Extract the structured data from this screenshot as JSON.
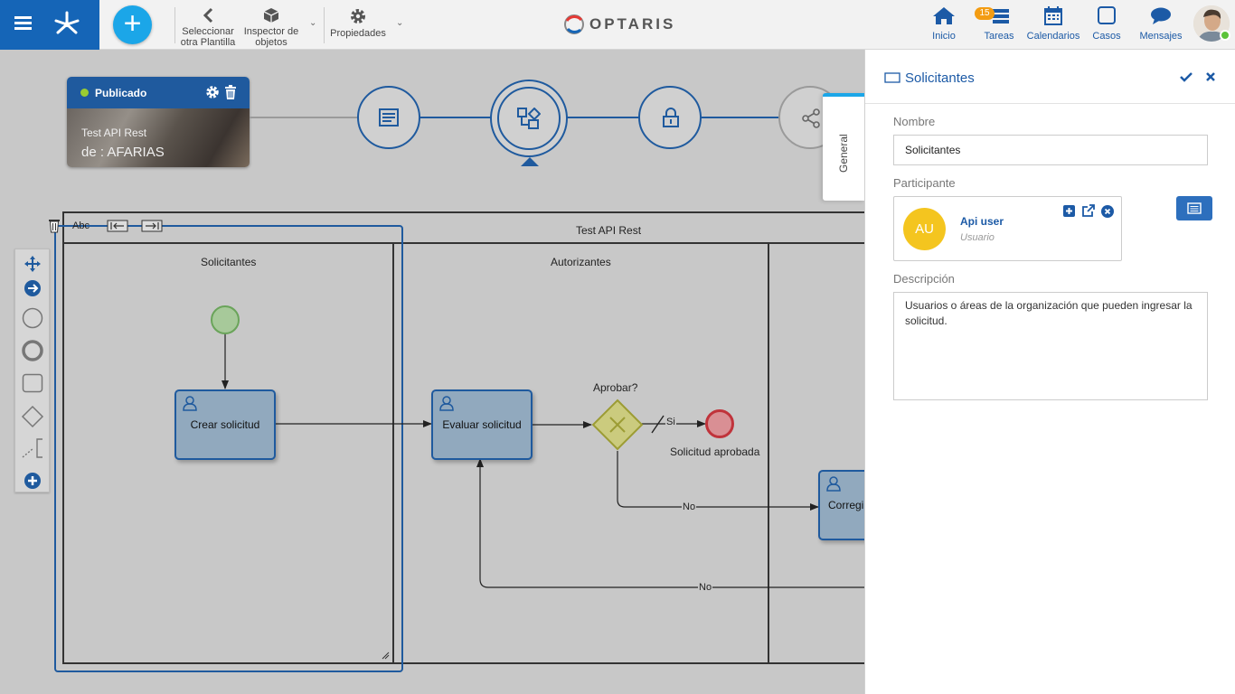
{
  "topbar": {
    "add_label": "+",
    "select_template": {
      "line1": "Seleccionar",
      "line2": "otra Plantilla"
    },
    "object_inspector": {
      "line1": "Inspector de",
      "line2": "objetos"
    },
    "properties": "Propiedades",
    "logo_text": "OPTARIS",
    "nav": [
      {
        "label": "Inicio",
        "icon": "home-icon"
      },
      {
        "label": "Tareas",
        "icon": "tasks-icon",
        "badge": "15"
      },
      {
        "label": "Calendarios",
        "icon": "calendar-icon"
      },
      {
        "label": "Casos",
        "icon": "cases-icon"
      },
      {
        "label": "Mensajes",
        "icon": "messages-icon"
      }
    ]
  },
  "process_card": {
    "status": "Publicado",
    "status_color": "#9acd32",
    "name": "Test API Rest",
    "author": "de : AFARIAS"
  },
  "diagram": {
    "text_tool": "Abc",
    "pool_title": "Test API Rest",
    "lanes": [
      "Solicitantes",
      "Autorizantes"
    ],
    "tasks": {
      "create": "Crear solicitud",
      "evaluate": "Evaluar solicitud",
      "correct": "Corregi"
    },
    "gateway_label": "Aprobar?",
    "end_label": "Solicitud aprobada",
    "edge_yes": "Si",
    "edge_no_1": "No",
    "edge_no_2": "No"
  },
  "panel": {
    "tab": "General",
    "title": "Solicitantes",
    "name_label": "Nombre",
    "name_value": "Solicitantes",
    "participant_label": "Participante",
    "participant": {
      "initials": "AU",
      "name": "Api user",
      "type": "Usuario",
      "avatar_color": "#f4c51f"
    },
    "description_label": "Descripción",
    "description": "Usuarios o áreas de la organización que pueden ingresar la solicitud."
  },
  "colors": {
    "primary": "#1565b7",
    "accent": "#1ba6e8",
    "diagram_line": "#1f5a9e"
  }
}
